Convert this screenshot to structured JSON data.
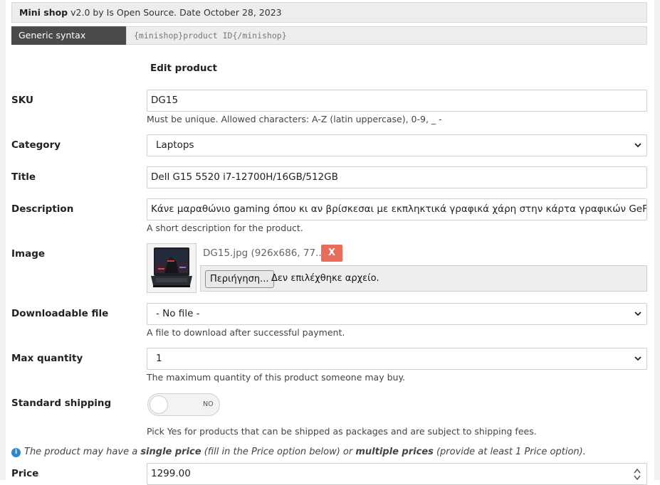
{
  "header": {
    "plugin_name": "Mini shop",
    "plugin_meta": "v2.0 by Is Open Source. Date October 28, 2023"
  },
  "syntax": {
    "label": "Generic syntax",
    "code": "{minishop}product ID{/minishop}"
  },
  "form": {
    "title": "Edit product",
    "sku": {
      "label": "SKU",
      "value": "DG15",
      "help": "Must be unique. Allowed characters: A-Z (latin uppercase), 0-9, _ -"
    },
    "category": {
      "label": "Category",
      "selected": "Laptops"
    },
    "title_field": {
      "label": "Title",
      "value": "Dell G15 5520 i7-12700H/16GB/512GB"
    },
    "description": {
      "label": "Description",
      "value": "Κάνε μαραθώνιο gaming όπου κι αν βρίσκεσαι με εκπληκτικά γραφικά χάρη στην κάρτα γραφικών GeForce RTX",
      "help": "A short description for the product."
    },
    "image": {
      "label": "Image",
      "filename": "DG15.jpg (926x686, 77....",
      "remove_label": "X",
      "browse_label": "Περιήγηση...",
      "file_status": "Δεν επιλέχθηκε αρχείο."
    },
    "downloadable": {
      "label": "Downloadable file",
      "selected": "- No file -",
      "help": "A file to download after successful payment."
    },
    "max_quantity": {
      "label": "Max quantity",
      "selected": "1",
      "help": "The maximum quantity of this product someone may buy."
    },
    "shipping": {
      "label": "Standard shipping",
      "toggle_text": "NO",
      "help": "Pick Yes for products that can be shipped as packages and are subject to shipping fees."
    },
    "pricing_info": {
      "icon": "info-icon",
      "part1": "The product may have a ",
      "strong1": "single price",
      "part2": " (fill in the Price option below) or ",
      "strong2": "multiple prices",
      "part3": " (provide at least 1 Price option)."
    },
    "price": {
      "label": "Price",
      "value": "1299.00"
    }
  },
  "colors": {
    "remove_button": "#e96b5a",
    "syntax_label_bg": "#4a4a4a",
    "info_icon": "#2e86c9"
  }
}
